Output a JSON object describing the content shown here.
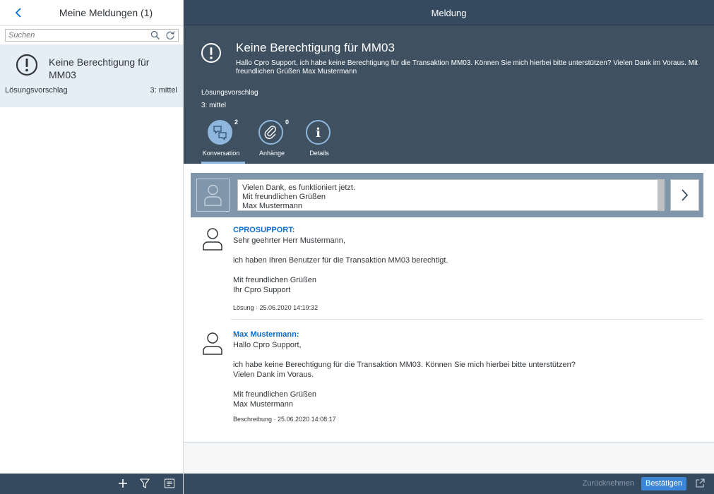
{
  "master": {
    "title": "Meine Meldungen (1)",
    "search_placeholder": "Suchen",
    "item": {
      "title": "Keine Berechtigung für MM03",
      "status": "Lösungsvorschlag",
      "priority": "3: mittel"
    }
  },
  "detail": {
    "title": "Meldung",
    "header": {
      "title": "Keine Berechtigung für MM03",
      "description": "Hallo Cpro Support, ich habe keine Berechtigung für die Transaktion MM03. Können Sie mich hierbei bitte unterstützen? Vielen Dank im Voraus. Mit freundlichen Grüßen Max Mustermann",
      "status": "Lösungsvorschlag",
      "priority": "3: mittel"
    },
    "tabs": [
      {
        "label": "Konversation",
        "count": "2",
        "icon": "conversation-icon"
      },
      {
        "label": "Anhänge",
        "count": "0",
        "icon": "paperclip-icon"
      },
      {
        "label": "Details",
        "count": "",
        "icon": "info-icon"
      }
    ],
    "composer_text": "Vielen Dank, es funktioniert jetzt.\nMit freundlichen Grüßen\nMax Mustermann",
    "entries": [
      {
        "author": "CPROSUPPORT:",
        "body": "Sehr geehrter Herr Mustermann,\n\nich haben Ihren Benutzer für die Transaktion MM03 berechtigt.\n\nMit freundlichen Grüßen\nIhr Cpro Support",
        "meta": "Lösung · 25.06.2020 14:19:32"
      },
      {
        "author": "Max Mustermann:",
        "body": "Hallo Cpro Support,\n\nich habe keine Berechtigung für die Transaktion MM03. Können Sie mich hierbei bitte unterstützen?\nVielen Dank im Voraus.\n\nMit freundlichen Grüßen\nMax Mustermann",
        "meta": "Beschreibung · 25.06.2020 14:08:17"
      }
    ],
    "footer": {
      "undo": "Zurücknehmen",
      "confirm": "Bestätigen"
    }
  },
  "colors": {
    "shell": "#354a5f",
    "object_header": "#3f5161",
    "accent": "#0a6ed1",
    "tab_active": "#8fb6dd",
    "selected_item": "#e5eef7"
  }
}
